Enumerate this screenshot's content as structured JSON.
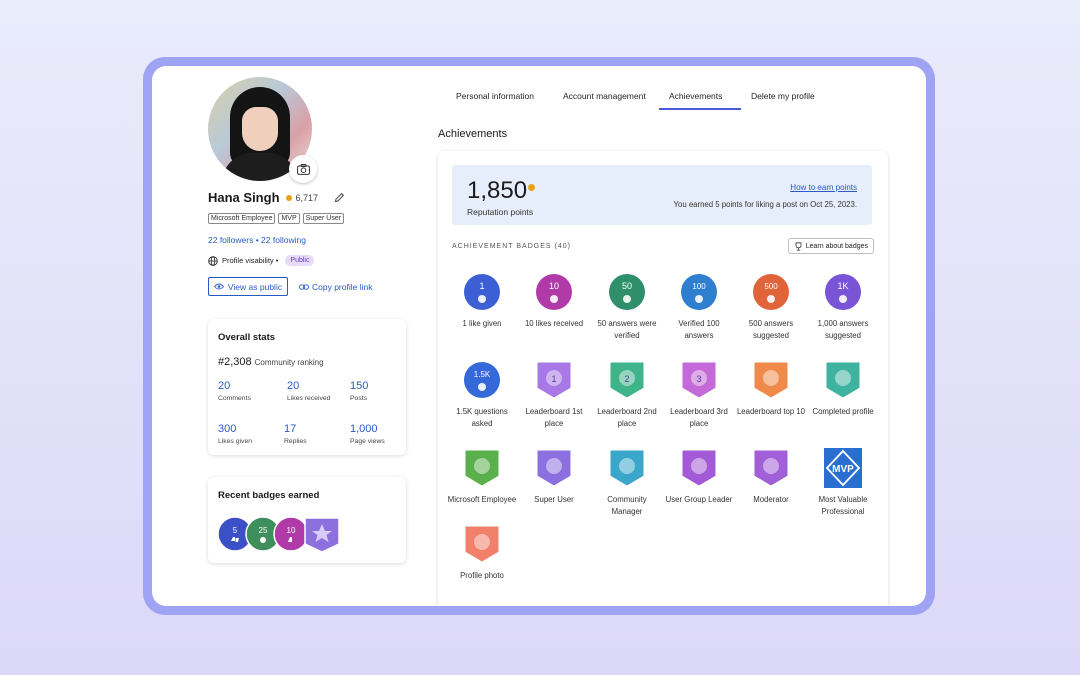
{
  "profile": {
    "name": "Hana Singh",
    "reputation_short": "6,717",
    "tags": [
      "Microsoft Employee",
      "MVP",
      "Super User"
    ],
    "followers": "22 followers • 22 following",
    "visibility_label": "Profile visability •",
    "visibility_value": "Public",
    "view_as_public": "View as public",
    "copy_link": "Copy profile link"
  },
  "stats": {
    "title": "Overall stats",
    "rank": "#2,308",
    "rank_label": "Community ranking",
    "items": [
      {
        "value": "20",
        "label": "Comments"
      },
      {
        "value": "20",
        "label": "Likes received"
      },
      {
        "value": "150",
        "label": "Posts"
      },
      {
        "value": "300",
        "label": "Likes given"
      },
      {
        "value": "17",
        "label": "Replies"
      },
      {
        "value": "1,000",
        "label": "Page views"
      }
    ]
  },
  "recent_badges": {
    "title": "Recent badges earned",
    "numbers": [
      "5",
      "25",
      "10"
    ]
  },
  "tabs": [
    "Personal information",
    "Account management",
    "Achievements",
    "Delete my profile"
  ],
  "achievements": {
    "title": "Achievements",
    "points": "1,850",
    "points_label": "Reputation points",
    "earn_link": "How to earn points",
    "earn_note": "You earned 5 points for liking a post on Oct 25, 2023.",
    "section_label": "ACHIEVEMENT BADGES (40)",
    "learn_button": "Learn about badges",
    "badges": [
      {
        "label": "1 like given",
        "num": "1",
        "color": "#3d5fd6"
      },
      {
        "label": "10 likes received",
        "num": "10",
        "color": "#b03aa8"
      },
      {
        "label": "50 answers were verified",
        "num": "50",
        "color": "#2f8f6a"
      },
      {
        "label": "Verified 100 answers",
        "num": "100",
        "color": "#2e7fd0"
      },
      {
        "label": "500 answers suggested",
        "num": "500",
        "color": "#e0633a"
      },
      {
        "label": "1,000 answers suggested",
        "num": "1K",
        "color": "#7a54d6"
      },
      {
        "label": "1.5K questions asked",
        "num": "1.5K",
        "color": "#3568d8"
      },
      {
        "label": "Leaderboard 1st place",
        "num": "1",
        "color": "#a778e6"
      },
      {
        "label": "Leaderboard 2nd place",
        "num": "2",
        "color": "#3fb38a"
      },
      {
        "label": "Leaderboard 3rd place",
        "num": "3",
        "color": "#c46ad8"
      },
      {
        "label": "Leaderboard top 10",
        "num": "",
        "color": "#f08a4a"
      },
      {
        "label": "Completed profile",
        "num": "",
        "color": "#3fb3a0"
      },
      {
        "label": "Microsoft Employee",
        "num": "",
        "color": "#5ab04a"
      },
      {
        "label": "Super User",
        "num": "",
        "color": "#8c70e0"
      },
      {
        "label": "Community Manager",
        "num": "",
        "color": "#3aa6c9"
      },
      {
        "label": "User Group Leader",
        "num": "",
        "color": "#a35ad6"
      },
      {
        "label": "Moderator",
        "num": "",
        "color": "#a160d8"
      },
      {
        "label": "Most Valuable Professional",
        "num": "MVP",
        "color": "#2a6fd0"
      },
      {
        "label": "Profile photo",
        "num": "",
        "color": "#f0806a"
      }
    ]
  }
}
